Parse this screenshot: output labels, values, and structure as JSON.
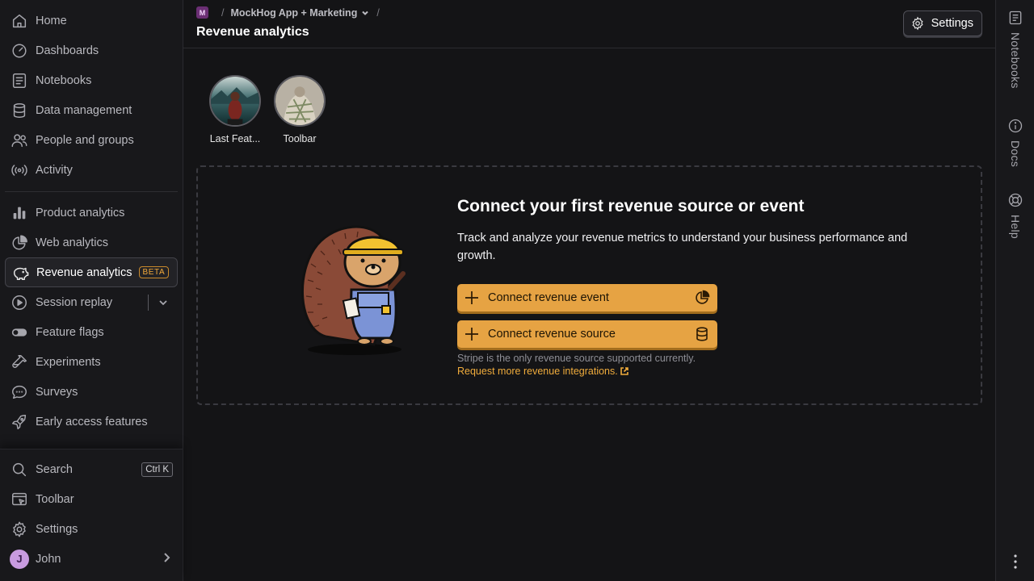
{
  "sidebar": {
    "top_items": [
      {
        "label": "Home",
        "icon": "home-icon"
      },
      {
        "label": "Dashboards",
        "icon": "gauge-icon"
      },
      {
        "label": "Notebooks",
        "icon": "notebook-icon"
      },
      {
        "label": "Data management",
        "icon": "database-icon"
      },
      {
        "label": "People and groups",
        "icon": "people-icon"
      },
      {
        "label": "Activity",
        "icon": "broadcast-icon"
      }
    ],
    "product_items": [
      {
        "label": "Product analytics",
        "icon": "bar-chart-icon"
      },
      {
        "label": "Web analytics",
        "icon": "pie-chart-icon"
      },
      {
        "label": "Revenue analytics",
        "icon": "piggy-bank-icon",
        "badge": "BETA",
        "active": true
      },
      {
        "label": "Session replay",
        "icon": "play-icon"
      },
      {
        "label": "Feature flags",
        "icon": "toggle-icon"
      },
      {
        "label": "Experiments",
        "icon": "flask-icon"
      },
      {
        "label": "Surveys",
        "icon": "message-icon"
      },
      {
        "label": "Early access features",
        "icon": "rocket-icon"
      }
    ],
    "bottom_items": {
      "search": "Search",
      "search_shortcut": "Ctrl K",
      "toolbar": "Toolbar",
      "settings": "Settings",
      "user": "John",
      "user_initial": "J"
    }
  },
  "header": {
    "project_initial": "M",
    "project": "MockHog App + Marketing",
    "title": "Revenue analytics",
    "settings_label": "Settings"
  },
  "shortcuts": [
    {
      "label": "Last Feat..."
    },
    {
      "label": "Toolbar"
    }
  ],
  "empty_state": {
    "title": "Connect your first revenue source or event",
    "description": "Track and analyze your revenue metrics to understand your business performance and growth.",
    "primary_button": "Connect revenue event",
    "secondary_button": "Connect revenue source",
    "note": "Stripe is the only revenue source supported currently.",
    "link": "Request more revenue integrations."
  },
  "rail": {
    "notebooks": "Notebooks",
    "docs": "Docs",
    "help": "Help"
  },
  "colors": {
    "accent": "#e6a343",
    "background": "#141416",
    "sidebar": "#18181b",
    "beta": "#f2a93b"
  }
}
